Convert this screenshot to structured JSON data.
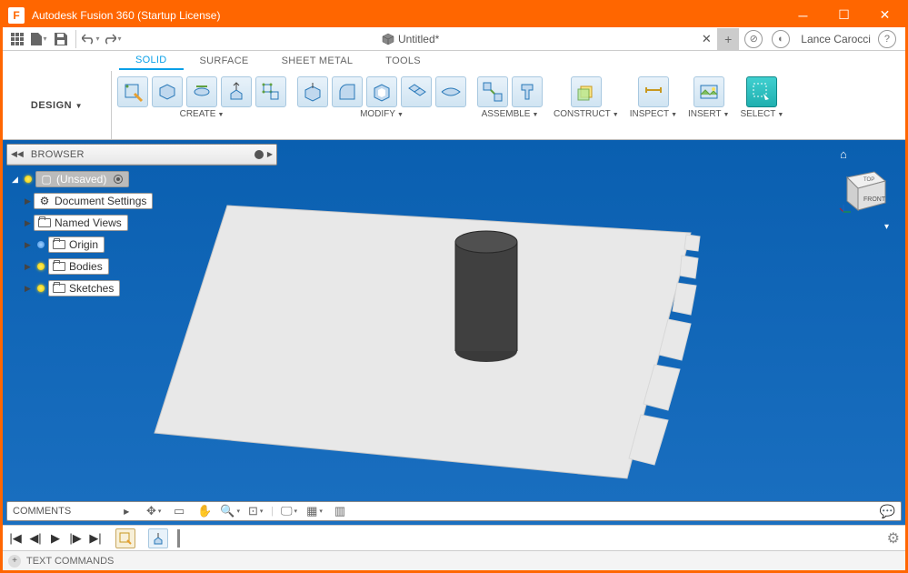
{
  "titlebar": {
    "title": "Autodesk Fusion 360 (Startup License)"
  },
  "quickbar": {
    "user_name": "Lance Carocci"
  },
  "tab": {
    "title": "Untitled*"
  },
  "ribbon_tabs": [
    "SOLID",
    "SURFACE",
    "SHEET METAL",
    "TOOLS"
  ],
  "workspace_btn": "DESIGN",
  "ribbon_groups": {
    "create": "CREATE",
    "modify": "MODIFY",
    "assemble": "ASSEMBLE",
    "construct": "CONSTRUCT",
    "inspect": "INSPECT",
    "insert": "INSERT",
    "select": "SELECT"
  },
  "browser": {
    "title": "BROWSER",
    "root": "(Unsaved)",
    "nodes": {
      "doc_settings": "Document Settings",
      "named_views": "Named Views",
      "origin": "Origin",
      "bodies": "Bodies",
      "sketches": "Sketches"
    }
  },
  "comments": {
    "title": "COMMENTS"
  },
  "viewcube": {
    "top": "TOP",
    "front": "FRONT"
  },
  "textcmd": {
    "title": "TEXT COMMANDS"
  }
}
